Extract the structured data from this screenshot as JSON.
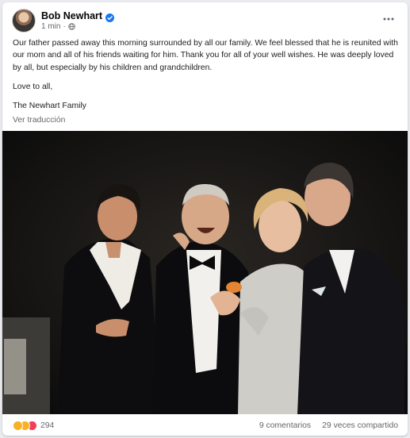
{
  "post": {
    "author": "Bob Newhart",
    "time": "1 min",
    "separator": "·",
    "paragraphs": [
      "Our father passed away this morning surrounded by all our family. We feel blessed that he is reunited with our mom and all of his friends waiting for him. Thank you for all of your well wishes. He was deeply loved by all, but especially by his children and grandchildren.",
      "Love to all,",
      "The Newhart Family"
    ],
    "translate_label": "Ver traducción"
  },
  "footer": {
    "reaction_count": "294",
    "comments": "9 comentarios",
    "shares": "29 veces compartido"
  },
  "icons": {
    "verified": "verified-badge-icon",
    "audience": "globe-icon",
    "more": "more-options-icon",
    "reactions": [
      "wow-reaction-icon",
      "sad-reaction-icon",
      "love-reaction-icon"
    ]
  },
  "colors": {
    "verified": "#1877f2",
    "secondary_text": "#65676b",
    "love": "#f33e58",
    "wow_sad": "#f7b125"
  }
}
